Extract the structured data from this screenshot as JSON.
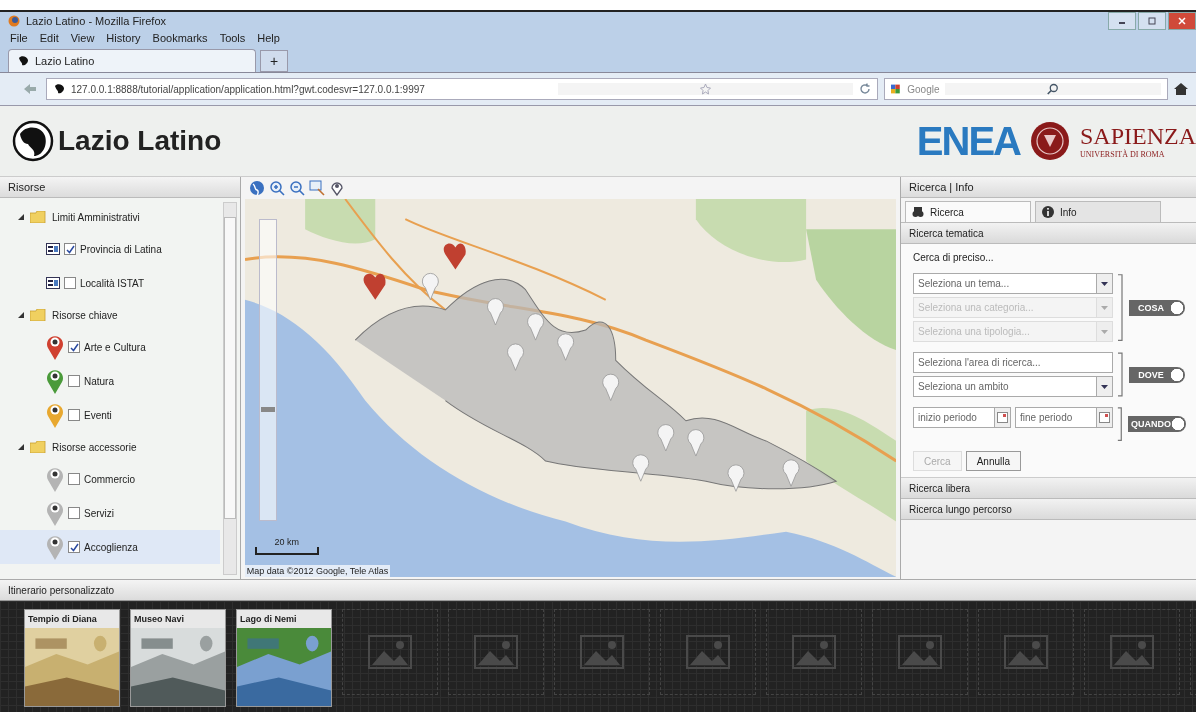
{
  "browser": {
    "title": "Lazio Latino - Mozilla Firefox",
    "menu": [
      "File",
      "Edit",
      "View",
      "History",
      "Bookmarks",
      "Tools",
      "Help"
    ],
    "tabs": [
      {
        "label": "Lazio Latino",
        "selected": true
      }
    ],
    "new_tab": "+",
    "url": "127.0.0.1:8888/tutorial/application/application.html?gwt.codesvr=127.0.0.1:9997",
    "search_placeholder": "Google"
  },
  "app": {
    "title": "Lazio Latino",
    "logo_enea": "ENEA",
    "logo_sapienza": "SAPIENZA",
    "logo_sapienza_sub": "UNIVERSITÀ DI ROMA"
  },
  "resources": {
    "title": "Risorse",
    "tree": [
      {
        "label": "Limiti Amministrativi",
        "expanded": true,
        "children": [
          {
            "kind": "layer",
            "label": "Provincia di Latina",
            "checked": true,
            "selected": false
          },
          {
            "kind": "layer",
            "label": "Località ISTAT",
            "checked": false,
            "selected": false
          }
        ]
      },
      {
        "label": "Risorse chiave",
        "expanded": true,
        "children": [
          {
            "kind": "marker",
            "label": "Arte e Cultura",
            "checked": true,
            "selected": false,
            "color": "#d04030"
          },
          {
            "kind": "marker",
            "label": "Natura",
            "checked": false,
            "selected": false,
            "color": "#4a9a3a"
          },
          {
            "kind": "marker",
            "label": "Eventi",
            "checked": false,
            "selected": false,
            "color": "#e8a830"
          }
        ]
      },
      {
        "label": "Risorse accessorie",
        "expanded": true,
        "children": [
          {
            "kind": "marker",
            "label": "Commercio",
            "checked": false,
            "selected": false,
            "color": "#b4b4b4"
          },
          {
            "kind": "marker",
            "label": "Servizi",
            "checked": false,
            "selected": false,
            "color": "#b4b4b4"
          },
          {
            "kind": "marker",
            "label": "Accoglienza",
            "checked": true,
            "selected": true,
            "color": "#b4b4b4"
          }
        ]
      }
    ]
  },
  "map": {
    "zoom": {
      "level": 0.36
    },
    "scale": "20 km",
    "attribution": "Map data ©2012 Google, Tele Atlas"
  },
  "search": {
    "title": "Ricerca | Info",
    "tabs": [
      {
        "label": "Ricerca",
        "selected": true
      },
      {
        "label": "Info",
        "selected": false
      }
    ],
    "section": "Ricerca tematica",
    "hint": "Cerca di preciso...",
    "groups": [
      {
        "label": "COSA",
        "on": true,
        "fields": [
          {
            "kind": "select",
            "placeholder": "Seleziona un tema...",
            "disabled": false
          },
          {
            "kind": "select",
            "placeholder": "Seleziona una categoria...",
            "disabled": true
          },
          {
            "kind": "select",
            "placeholder": "Seleziona una tipologia...",
            "disabled": true
          }
        ]
      },
      {
        "label": "DOVE",
        "on": true,
        "fields": [
          {
            "kind": "text",
            "placeholder": "Seleziona l'area di ricerca...",
            "disabled": false
          },
          {
            "kind": "select",
            "placeholder": "Seleziona un ambito",
            "disabled": false
          }
        ]
      },
      {
        "label": "QUANDO",
        "on": true,
        "fields": [
          {
            "kind": "date",
            "placeholder": "inizio periodo",
            "disabled": false
          },
          {
            "kind": "date",
            "placeholder": "fine periodo",
            "disabled": false
          }
        ]
      }
    ],
    "buttons": [
      {
        "label": "Cerca",
        "disabled": true
      },
      {
        "label": "Annulla",
        "disabled": false
      }
    ],
    "sections": [
      "Ricerca libera",
      "Ricerca lungo percorso"
    ]
  },
  "itinerary": {
    "title": "Itinerario personalizzato",
    "slots": [
      {
        "label": "Tempio di Diana"
      },
      {
        "label": "Museo Navi"
      },
      {
        "label": "Lago di Nemi"
      },
      {
        "kind": "empty"
      },
      {
        "kind": "empty"
      },
      {
        "kind": "empty"
      },
      {
        "kind": "empty"
      },
      {
        "kind": "empty"
      },
      {
        "kind": "empty"
      },
      {
        "kind": "empty"
      },
      {
        "kind": "empty"
      },
      {
        "kind": "empty"
      }
    ]
  }
}
